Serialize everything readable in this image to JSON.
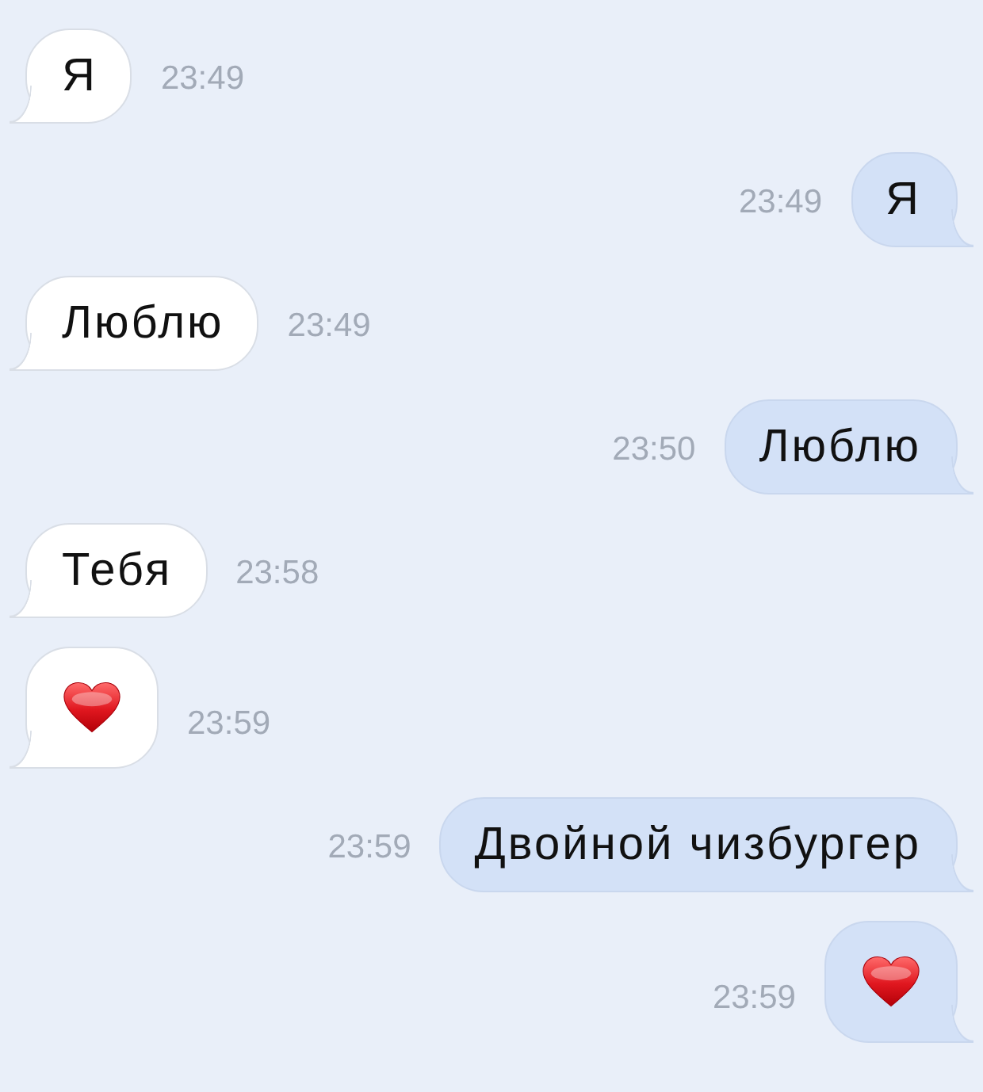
{
  "messages": [
    {
      "outgoing": false,
      "kind": "text",
      "text": "Я",
      "time": "23:49"
    },
    {
      "outgoing": true,
      "kind": "text",
      "text": "Я",
      "time": "23:49"
    },
    {
      "outgoing": false,
      "kind": "text",
      "text": "Люблю",
      "time": "23:49"
    },
    {
      "outgoing": true,
      "kind": "text",
      "text": "Люблю",
      "time": "23:50"
    },
    {
      "outgoing": false,
      "kind": "text",
      "text": "Тебя",
      "time": "23:58"
    },
    {
      "outgoing": false,
      "kind": "emoji",
      "time": "23:59"
    },
    {
      "outgoing": true,
      "kind": "text",
      "text": "Двойной чизбургер",
      "time": "23:59"
    },
    {
      "outgoing": true,
      "kind": "emoji",
      "time": "23:59"
    }
  ]
}
